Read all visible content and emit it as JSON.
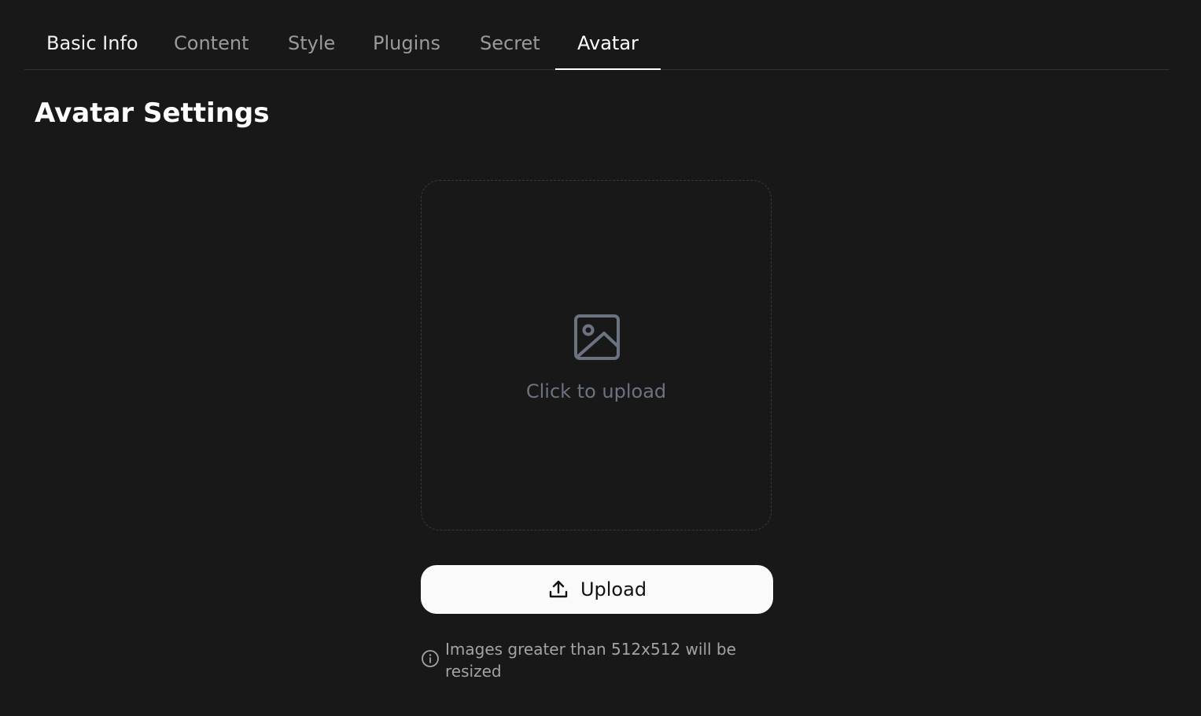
{
  "tabs": [
    {
      "label": "Basic Info",
      "active": false
    },
    {
      "label": "Content",
      "active": false
    },
    {
      "label": "Style",
      "active": false
    },
    {
      "label": "Plugins",
      "active": false
    },
    {
      "label": "Secret",
      "active": false
    },
    {
      "label": "Avatar",
      "active": true
    }
  ],
  "page": {
    "title": "Avatar Settings"
  },
  "dropzone": {
    "icon": "image-icon",
    "label": "Click to upload"
  },
  "upload": {
    "icon": "upload-icon",
    "label": "Upload"
  },
  "hint": {
    "icon": "info-icon",
    "text": "Images greater than 512x512 will be resized"
  },
  "colors": {
    "background": "#181818",
    "active_tab": "#ffffff",
    "inactive_tab": "#9a9a9a",
    "placeholder": "#6b7280",
    "button_bg": "#fafafa"
  }
}
